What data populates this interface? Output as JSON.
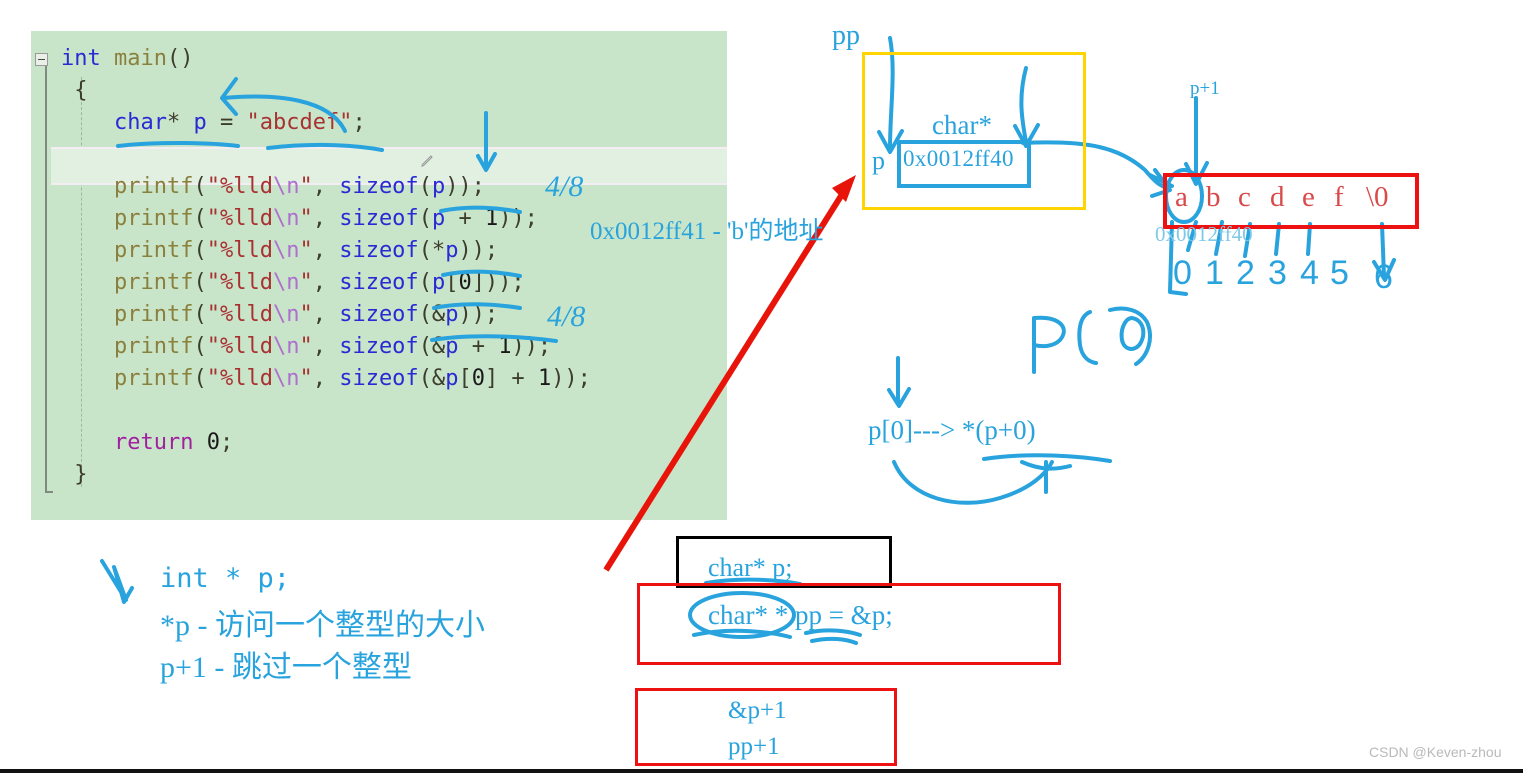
{
  "editor": {
    "background_color": "#c9e5c9",
    "fold_icon": "collapse-minus-icon",
    "edit_icon": "pencil-icon",
    "code_lines": [
      "int main()",
      "{",
      "    char* p = \"abcdef\";",
      "",
      "    printf(\"%lld\\n\", sizeof(p));",
      "    printf(\"%lld\\n\", sizeof(p + 1));",
      "    printf(\"%lld\\n\", sizeof(*p));",
      "    printf(\"%lld\\n\", sizeof(p[0]));",
      "    printf(\"%lld\\n\", sizeof(&p));",
      "    printf(\"%lld\\n\", sizeof(&p + 1));",
      "    printf(\"%lld\\n\", sizeof(&p[0] + 1));",
      "",
      "    return 0;",
      "}"
    ],
    "tokens": {
      "keyword_int": "int",
      "fn_main": "main",
      "keyword_char": "char",
      "var_p": "p",
      "string_abcdef": "\"abcdef\"",
      "fn_printf": "printf",
      "format_str": "\"%lld",
      "escape_n": "\\n",
      "fn_sizeof": "sizeof",
      "keyword_return": "return",
      "value_zero": "0"
    }
  },
  "annotations": {
    "ink_color": "#29a3dd",
    "sizeof_p_note": "4/8",
    "sizeof_amp_p_note": "4/8",
    "addr_note": "0x0012ff41 - 'b'的地址",
    "p0_expansion": "p[0]---> *(p+0)",
    "p0_handwritten": "P [0]"
  },
  "pointer_diagram": {
    "yellow_box_color": "#ffd400",
    "pp_label": "pp",
    "charstar_label": "char*",
    "p_label": "p",
    "p_value": "0x0012ff40",
    "p_plus_1_label": "p+1",
    "array_box_color": "#ee1111",
    "array_address": "0x0012ff40",
    "array_cells": [
      "a",
      "b",
      "c",
      "d",
      "e",
      "f",
      "\\0"
    ],
    "array_indices": [
      "0",
      "1",
      "2",
      "3",
      "4",
      "5",
      "6"
    ]
  },
  "bottom_left_notes": {
    "line1": "int * p;",
    "line2": "*p - 访问一个整型的大小",
    "line3": "p+1 - 跳过一个整型"
  },
  "bottom_boxes": {
    "black_box_text": "char* p;",
    "red_box_decl": "char* * pp = &p;",
    "red_box_lines": [
      "&p+1",
      "pp+1"
    ]
  },
  "watermark": {
    "text": "CSDN @Keven-zhou"
  }
}
